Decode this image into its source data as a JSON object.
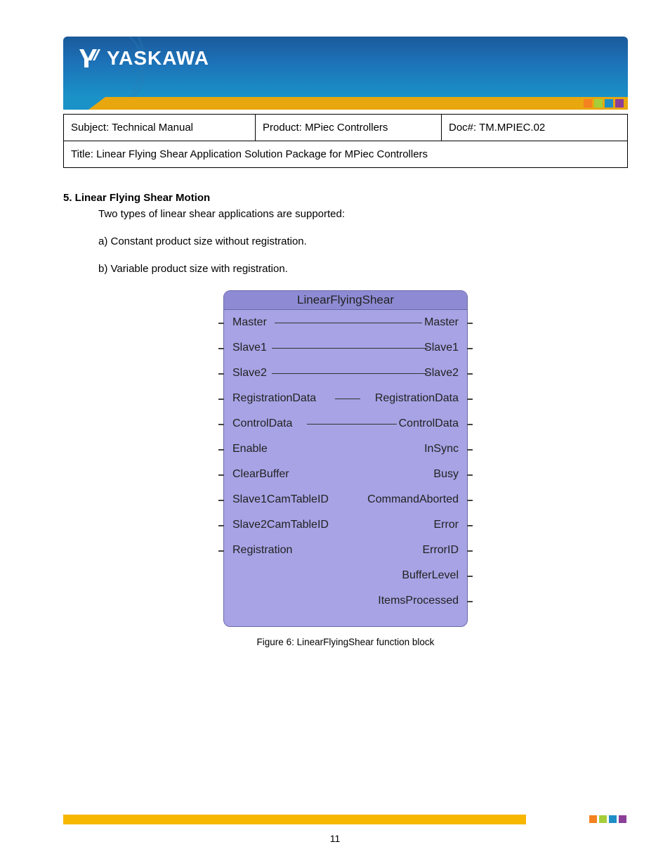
{
  "brand": "YASKAWA",
  "info": {
    "subject_label": "Subject:",
    "subject_value": "Technical Manual",
    "product_label": "Product:",
    "product_value": "MPiec Controllers",
    "doc_label": "Doc#:",
    "doc_value": "TM.MPIEC.02",
    "title_label": "Title:",
    "title_value": "Linear Flying Shear Application Solution Package for MPiec Controllers"
  },
  "section": {
    "heading": "5. Linear Flying Shear Motion",
    "intro": "Two types of linear shear applications are supported:",
    "item_a": "a) Constant product size without registration.",
    "item_b": "b) Variable product size with registration."
  },
  "fb": {
    "title": "LinearFlyingShear",
    "rows": [
      {
        "left": "Master",
        "right": "Master",
        "lline": true,
        "rline": true,
        "tickL": true,
        "tickR": true,
        "lineL": 72,
        "lineW": 210
      },
      {
        "left": "Slave1",
        "right": "Slave1",
        "lline": true,
        "rline": true,
        "tickL": true,
        "tickR": true,
        "lineL": 68,
        "lineW": 222
      },
      {
        "left": "Slave2",
        "right": "Slave2",
        "lline": true,
        "rline": true,
        "tickL": true,
        "tickR": true,
        "lineL": 68,
        "lineW": 222
      },
      {
        "left": "RegistrationData",
        "right": "RegistrationData",
        "lline": true,
        "rline": true,
        "tickL": true,
        "tickR": true,
        "lineL": 158,
        "lineW": 36
      },
      {
        "left": "ControlData",
        "right": "ControlData",
        "lline": true,
        "rline": true,
        "tickL": true,
        "tickR": true,
        "lineL": 118,
        "lineW": 128
      },
      {
        "left": "Enable",
        "right": "InSync",
        "tickL": true,
        "tickR": true
      },
      {
        "left": "ClearBuffer",
        "right": "Busy",
        "tickL": true,
        "tickR": true
      },
      {
        "left": "Slave1CamTableID",
        "right": "CommandAborted",
        "tickL": true,
        "tickR": true
      },
      {
        "left": "Slave2CamTableID",
        "right": "Error",
        "tickL": true,
        "tickR": true
      },
      {
        "left": "Registration",
        "right": "ErrorID",
        "tickL": true,
        "tickR": true
      },
      {
        "left": "",
        "right": "BufferLevel",
        "tickR": true
      },
      {
        "left": "",
        "right": "ItemsProcessed",
        "tickR": true
      }
    ]
  },
  "caption": "Figure 6: LinearFlyingShear function block",
  "page_number": "11"
}
